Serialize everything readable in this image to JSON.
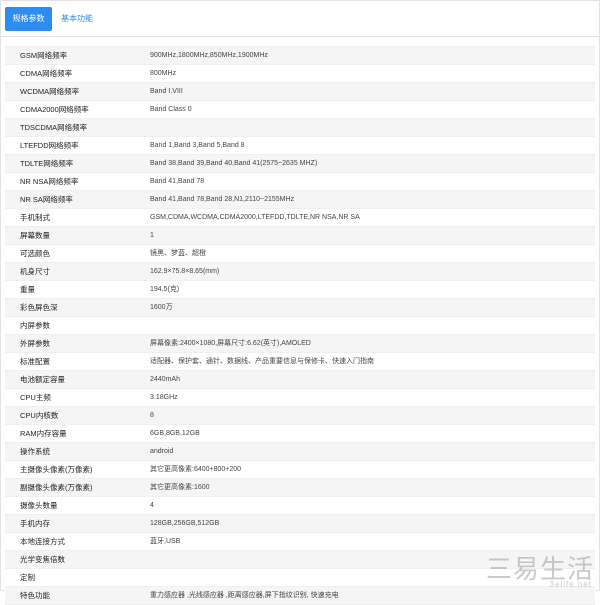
{
  "tabs": [
    {
      "label": "规格参数",
      "active": true
    },
    {
      "label": "基本功能",
      "active": false
    }
  ],
  "specs": [
    {
      "key": "GSM网络频率",
      "value": "900MHz,1800MHz,850MHz,1900MHz"
    },
    {
      "key": "CDMA网络频率",
      "value": "800MHz"
    },
    {
      "key": "WCDMA网络频率",
      "value": "Band Ⅰ.VIII"
    },
    {
      "key": "CDMA2000网络频率",
      "value": "Band Class 0"
    },
    {
      "key": "TDSCDMA网络频率",
      "value": ""
    },
    {
      "key": "LTEFDD网络频率",
      "value": "Band 1,Band 3,Band 5,Band 8"
    },
    {
      "key": "TDLTE网络频率",
      "value": "Band 38,Band 39,Band 40,Band 41(2575~2635 MHZ)"
    },
    {
      "key": "NR NSA网络频率",
      "value": "Band 41,Band 78"
    },
    {
      "key": "NR SA网络频率",
      "value": "Band 41,Band 78,Band 28,N1,2110~2155MHz"
    },
    {
      "key": "手机制式",
      "value": "GSM,CDMA,WCDMA,CDMA2000,LTEFDD,TDLTE,NR NSA,NR SA"
    },
    {
      "key": "屏幕数量",
      "value": "1"
    },
    {
      "key": "可选颜色",
      "value": "镜黑、梦蓝、超橙"
    },
    {
      "key": "机身尺寸",
      "value": "162.9×75.8×8.65(mm)"
    },
    {
      "key": "重量",
      "value": "194.5(克)"
    },
    {
      "key": "彩色屏色深",
      "value": "1600万"
    },
    {
      "key": "内屏参数",
      "value": ""
    },
    {
      "key": "外屏参数",
      "value": "屏幕像素:2400×1080,屏幕尺寸:6.62(英寸),AMOLED"
    },
    {
      "key": "标准配置",
      "value": "适配器、保护套、通针、数据线、产品重要信息与保修卡、快速入门指南"
    },
    {
      "key": "电池额定容量",
      "value": "2440mAh"
    },
    {
      "key": "CPU主频",
      "value": "3.18GHz"
    },
    {
      "key": "CPU内核数",
      "value": "8"
    },
    {
      "key": "RAM内存容量",
      "value": "6GB,8GB,12GB"
    },
    {
      "key": "操作系统",
      "value": "android"
    },
    {
      "key": "主摄像头像素(万像素)",
      "value": "其它更高像素:6400+800+200"
    },
    {
      "key": "副摄像头像素(万像素)",
      "value": "其它更高像素:1600"
    },
    {
      "key": "摄像头数量",
      "value": "4"
    },
    {
      "key": "手机内存",
      "value": "128GB,256GB,512GB"
    },
    {
      "key": "本地连接方式",
      "value": "蓝牙,USB"
    },
    {
      "key": "光学变焦倍数",
      "value": ""
    },
    {
      "key": "定制",
      "value": ""
    },
    {
      "key": "特色功能",
      "value": "重力感应器 ,光线感应器 ,距离感应器,屏下指纹识别, 快速充电"
    }
  ],
  "watermark": {
    "text": "三易生活",
    "sub": "3elife.net"
  }
}
